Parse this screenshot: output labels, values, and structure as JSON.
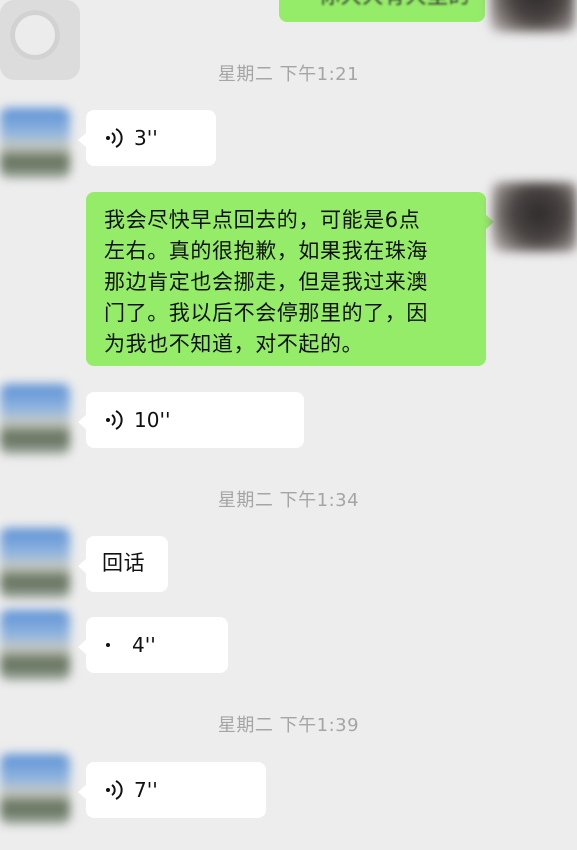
{
  "top_message": {
    "text": "你大大有大里的"
  },
  "timestamps": [
    "星期二 下午1:21",
    "星期二 下午1:34",
    "星期二 下午1:39"
  ],
  "messages": [
    {
      "type": "voice",
      "sender": "left",
      "duration": "3''"
    },
    {
      "type": "text",
      "sender": "right",
      "text": "我会尽快早点回去的，可能是6点\n左右。真的很抱歉，如果我在珠海\n那边肯定也会挪走，但是我过来澳\n门了。我以后不会停那里的了，因\n为我也不知道，对不起的。"
    },
    {
      "type": "voice",
      "sender": "left",
      "duration": "10''"
    },
    {
      "type": "text",
      "sender": "left",
      "text": "回话"
    },
    {
      "type": "voice",
      "sender": "left",
      "duration": "4''"
    },
    {
      "type": "voice",
      "sender": "left",
      "duration": "7''"
    }
  ],
  "colors": {
    "background": "#ededed",
    "incoming_bubble": "#ffffff",
    "outgoing_bubble": "#95ec69",
    "timestamp": "#a5a5a5"
  }
}
